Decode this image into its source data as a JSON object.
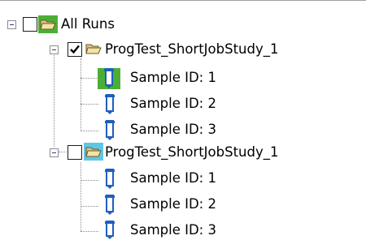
{
  "tree": {
    "root": {
      "label": "All Runs",
      "checked": false,
      "expanded": true,
      "icon": "folder-open-icon"
    },
    "runs": [
      {
        "label": "ProgTest_ShortJobStudy_1",
        "checked": true,
        "expanded": true,
        "icon": "folder-open-icon",
        "samples": [
          "Sample ID: 1",
          "Sample ID: 2",
          "Sample ID: 3"
        ]
      },
      {
        "label": "ProgTest_ShortJobStudy_1",
        "checked": false,
        "expanded": true,
        "icon": "folder-open-icon",
        "samples": [
          "Sample ID: 1",
          "Sample ID: 2",
          "Sample ID: 3"
        ]
      }
    ]
  },
  "colors": {
    "selection_green": "#4caf35",
    "selection_blue": "#5fc7e6",
    "vial_blue": "#1f5fbf"
  }
}
